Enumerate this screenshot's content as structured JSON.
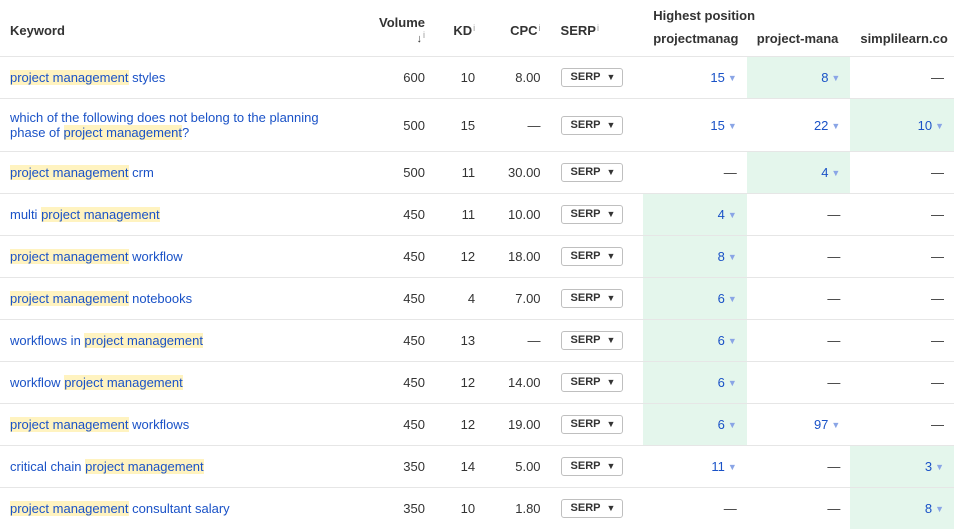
{
  "columns": {
    "keyword": "Keyword",
    "volume": "Volume",
    "kd": "KD",
    "cpc": "CPC",
    "serp": "SERP",
    "highest_position": "Highest position"
  },
  "sort_indicator": "↓",
  "info_glyph": "i",
  "serp_button_label": "SERP",
  "domains": [
    "projectmanag",
    "project-mana",
    "simplilearn.co"
  ],
  "highlight_term": "project management",
  "rows": [
    {
      "keyword": "project management styles",
      "volume": "600",
      "kd": "10",
      "cpc": "8.00",
      "positions": [
        "15",
        "8",
        "—"
      ],
      "best_index": 1
    },
    {
      "keyword": "which of the following does not belong to the planning phase of project management?",
      "volume": "500",
      "kd": "15",
      "cpc": "—",
      "positions": [
        "15",
        "22",
        "10"
      ],
      "best_index": 2
    },
    {
      "keyword": "project management crm",
      "volume": "500",
      "kd": "11",
      "cpc": "30.00",
      "positions": [
        "—",
        "4",
        "—"
      ],
      "best_index": 1
    },
    {
      "keyword": "multi project management",
      "volume": "450",
      "kd": "11",
      "cpc": "10.00",
      "positions": [
        "4",
        "—",
        "—"
      ],
      "best_index": 0
    },
    {
      "keyword": "project management workflow",
      "volume": "450",
      "kd": "12",
      "cpc": "18.00",
      "positions": [
        "8",
        "—",
        "—"
      ],
      "best_index": 0
    },
    {
      "keyword": "project management notebooks",
      "volume": "450",
      "kd": "4",
      "cpc": "7.00",
      "positions": [
        "6",
        "—",
        "—"
      ],
      "best_index": 0
    },
    {
      "keyword": "workflows in project management",
      "volume": "450",
      "kd": "13",
      "cpc": "—",
      "positions": [
        "6",
        "—",
        "—"
      ],
      "best_index": 0
    },
    {
      "keyword": "workflow project management",
      "volume": "450",
      "kd": "12",
      "cpc": "14.00",
      "positions": [
        "6",
        "—",
        "—"
      ],
      "best_index": 0
    },
    {
      "keyword": "project management workflows",
      "volume": "450",
      "kd": "12",
      "cpc": "19.00",
      "positions": [
        "6",
        "97",
        "—"
      ],
      "best_index": 0
    },
    {
      "keyword": "critical chain project management",
      "volume": "350",
      "kd": "14",
      "cpc": "5.00",
      "positions": [
        "11",
        "—",
        "3"
      ],
      "best_index": 2
    },
    {
      "keyword": "project management consultant salary",
      "volume": "350",
      "kd": "10",
      "cpc": "1.80",
      "positions": [
        "—",
        "—",
        "8"
      ],
      "best_index": 2
    }
  ]
}
